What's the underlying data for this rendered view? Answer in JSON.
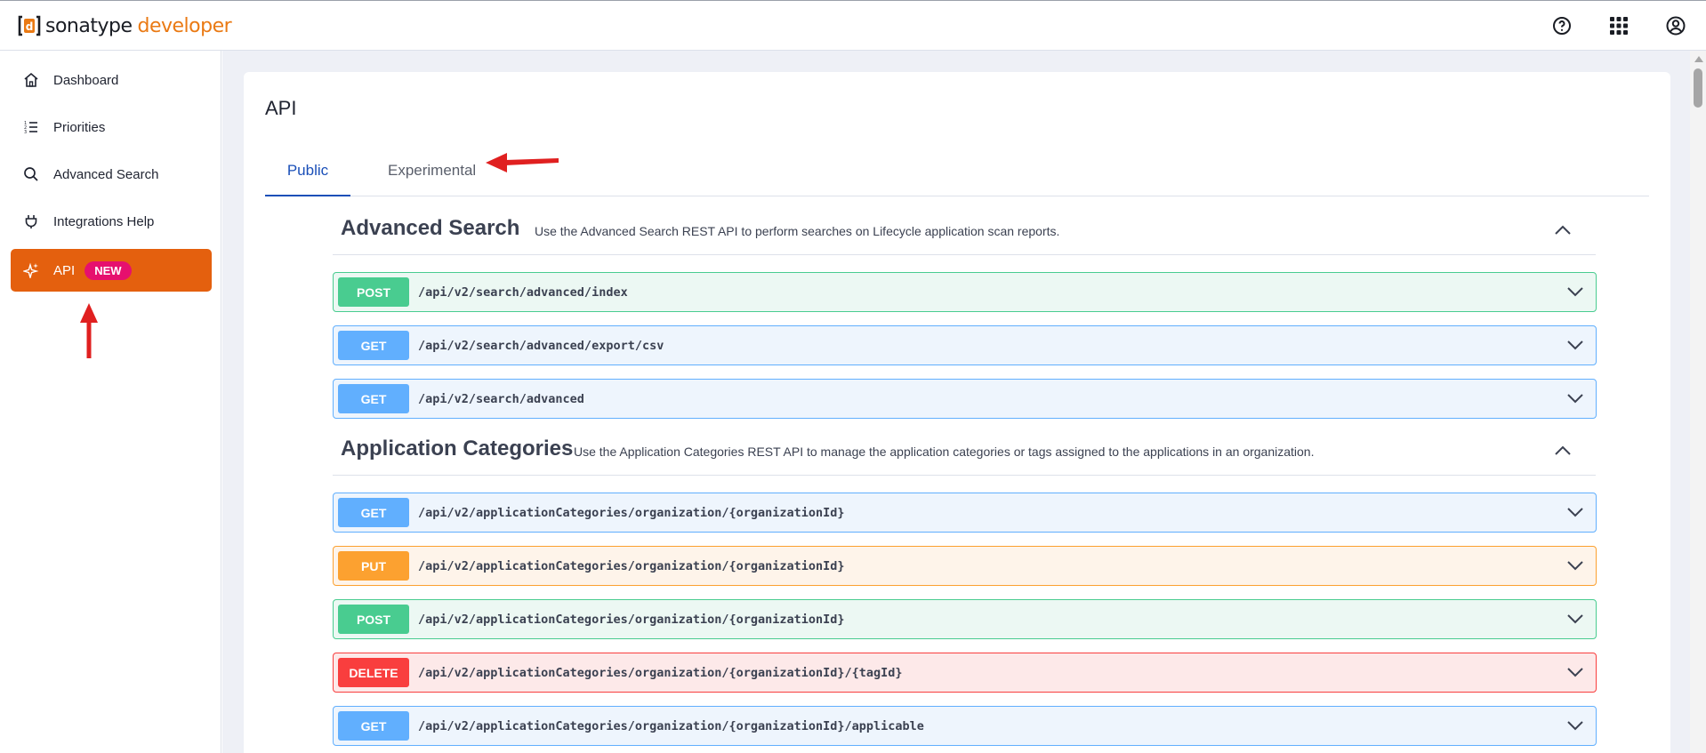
{
  "header": {
    "brand": "sonatype",
    "product": "developer",
    "icons": [
      "help-icon",
      "apps-grid-icon",
      "account-icon"
    ],
    "brand_color": "#ea7a14"
  },
  "sidebar": {
    "items": [
      {
        "label": "Dashboard",
        "icon": "home-icon"
      },
      {
        "label": "Priorities",
        "icon": "priorities-list-icon"
      },
      {
        "label": "Advanced Search",
        "icon": "search-icon"
      },
      {
        "label": "Integrations Help",
        "icon": "plug-icon"
      },
      {
        "label": "API",
        "icon": "sparkle-icon",
        "badge": "NEW",
        "active": true
      }
    ],
    "active_color": "#e4600e",
    "badge_color": "#e6106e"
  },
  "main": {
    "title": "API",
    "tabs": [
      {
        "label": "Public",
        "selected": true
      },
      {
        "label": "Experimental",
        "selected": false
      }
    ],
    "sections": [
      {
        "title": "Advanced Search",
        "description": "Use the Advanced Search REST API to perform searches on Lifecycle application scan reports.",
        "operations": [
          {
            "method": "POST",
            "path": "/api/v2/search/advanced/index"
          },
          {
            "method": "GET",
            "path": "/api/v2/search/advanced/export/csv"
          },
          {
            "method": "GET",
            "path": "/api/v2/search/advanced"
          }
        ]
      },
      {
        "title": "Application Categories",
        "description": "Use the Application Categories REST API to manage the application categories or tags assigned to the applications in an organization.",
        "operations": [
          {
            "method": "GET",
            "path": "/api/v2/applicationCategories/organization/{organizationId}"
          },
          {
            "method": "PUT",
            "path": "/api/v2/applicationCategories/organization/{organizationId}"
          },
          {
            "method": "POST",
            "path": "/api/v2/applicationCategories/organization/{organizationId}"
          },
          {
            "method": "DELETE",
            "path": "/api/v2/applicationCategories/organization/{organizationId}/{tagId}"
          },
          {
            "method": "GET",
            "path": "/api/v2/applicationCategories/organization/{organizationId}/applicable"
          }
        ]
      }
    ],
    "method_colors": {
      "POST": "#49cc90",
      "GET": "#61affe",
      "PUT": "#fca130",
      "DELETE": "#f93e3e"
    },
    "annotation_color": "#e02020"
  }
}
